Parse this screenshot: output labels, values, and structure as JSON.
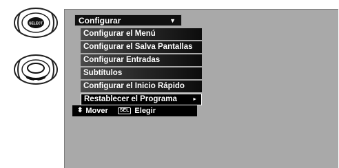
{
  "remotes": [
    {
      "label": "SELECT"
    },
    {
      "label": ""
    }
  ],
  "menu": {
    "title": "Configurar",
    "title_arrow": "▼",
    "items": [
      {
        "label": "Configurar el Menú",
        "selected": false
      },
      {
        "label": "Configurar el Salva Pantallas",
        "selected": false
      },
      {
        "label": "Configurar Entradas",
        "selected": false
      },
      {
        "label": "Subtítulos",
        "selected": false
      },
      {
        "label": "Configurar el Inicio Rápido",
        "selected": false
      },
      {
        "label": "Restablecer el Programa",
        "selected": true,
        "submenu_arrow": "►"
      }
    ]
  },
  "help": {
    "move_icon": "⬍",
    "move_label": "Mover",
    "select_key": "SEL",
    "select_label": "Elegir"
  },
  "colors": {
    "screen_bg": "#a9a9a9",
    "menu_bg": "#000000",
    "text": "#ffffff"
  }
}
